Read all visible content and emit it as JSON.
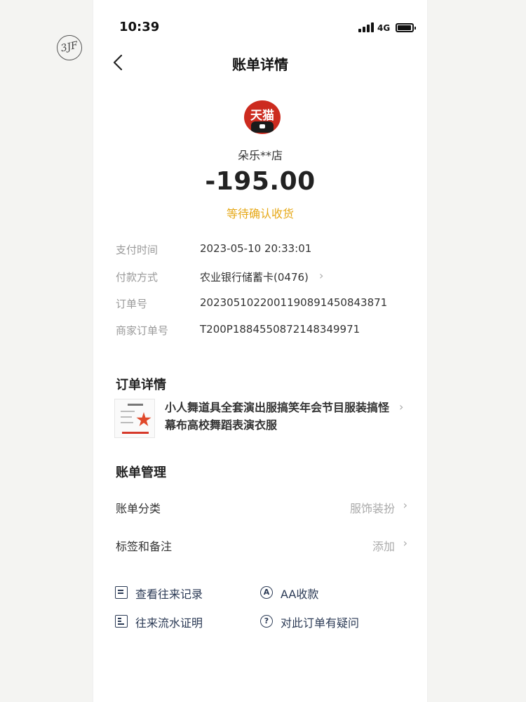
{
  "status_bar": {
    "time": "10:39",
    "network": "4G"
  },
  "handwritten_mark": "3JF",
  "header": {
    "title": "账单详情"
  },
  "merchant": {
    "logo_text": "天猫",
    "name": "朵乐**店",
    "amount": "-195.00",
    "status": "等待确认收货"
  },
  "details": [
    {
      "label": "支付时间",
      "value": "2023-05-10 20:33:01"
    },
    {
      "label": "付款方式",
      "value": "农业银行储蓄卡(0476)",
      "has_arrow": true
    },
    {
      "label": "订单号",
      "value": "2023051022001190891450843871"
    },
    {
      "label": "商家订单号",
      "value": "T200P1884550872148349971"
    }
  ],
  "order_section": {
    "title": "订单详情",
    "product_title": "小人舞道具全套演出服搞笑年会节目服装搞怪幕布高校舞蹈表演衣服"
  },
  "manage_section": {
    "title": "账单管理",
    "rows": [
      {
        "label": "账单分类",
        "value": "服饰装扮"
      },
      {
        "label": "标签和备注",
        "value": "添加"
      }
    ]
  },
  "actions": [
    {
      "label": "查看往来记录",
      "icon": "record-icon"
    },
    {
      "label": "AA收款",
      "icon": "aa-icon"
    },
    {
      "label": "往来流水证明",
      "icon": "statement-icon"
    },
    {
      "label": "对此订单有疑问",
      "icon": "question-icon"
    }
  ],
  "colors": {
    "status": "#e6a817",
    "logo": "#cc2b1f",
    "action_text": "#2b3a55"
  }
}
